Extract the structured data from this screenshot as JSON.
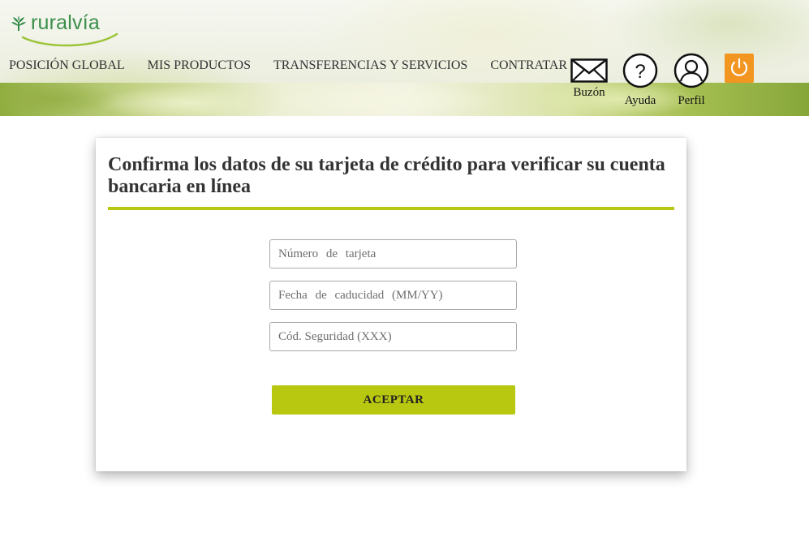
{
  "brand": {
    "name": "ruralvía",
    "accent_color": "#3a8f4a",
    "icon": "wheat-leaf-icon"
  },
  "nav": [
    {
      "label": "POSICIÓN GLOBAL"
    },
    {
      "label": "MIS PRODUCTOS"
    },
    {
      "label": "TRANSFERENCIAS Y SERVICIOS"
    },
    {
      "label": "CONTRATAR"
    }
  ],
  "header_actions": {
    "buzon": {
      "label": "Buzón",
      "icon": "envelope-icon"
    },
    "ayuda": {
      "label": "Ayuda",
      "icon": "question-icon"
    },
    "perfil": {
      "label": "Perfil",
      "icon": "user-icon"
    },
    "logout": {
      "icon": "power-icon",
      "color": "#f39521"
    }
  },
  "form": {
    "title": "Confirma los datos de su tarjeta de crédito para verificar su cuenta bancaria en línea",
    "accent_color": "#b8c70f",
    "fields": {
      "card_number": {
        "placeholder": "Número de tarjeta",
        "value": ""
      },
      "expiry": {
        "placeholder": "Fecha de caducidad (MM/YY)",
        "value": ""
      },
      "security_code": {
        "placeholder": "Cód. Seguridad (XXX)",
        "value": ""
      }
    },
    "submit_label": "ACEPTAR"
  }
}
